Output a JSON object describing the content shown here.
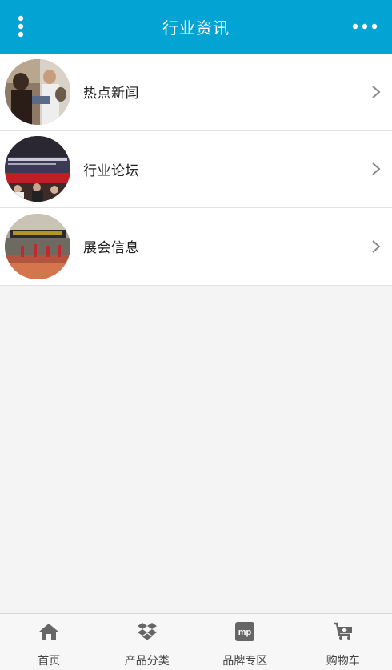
{
  "header": {
    "title": "行业资讯",
    "menu_icon": "vertical-dots-icon",
    "more_icon": "horizontal-dots-icon",
    "color": "#03a3d4"
  },
  "list": {
    "items": [
      {
        "label": "热点新闻",
        "icon": "chevron-right-icon"
      },
      {
        "label": "行业论坛",
        "icon": "chevron-right-icon"
      },
      {
        "label": "展会信息",
        "icon": "chevron-right-icon"
      }
    ]
  },
  "footer": {
    "tabs": [
      {
        "label": "首页",
        "icon": "home-icon"
      },
      {
        "label": "产品分类",
        "icon": "dropbox-icon"
      },
      {
        "label": "品牌专区",
        "icon": "mp-icon"
      },
      {
        "label": "购物车",
        "icon": "cart-icon"
      }
    ]
  }
}
